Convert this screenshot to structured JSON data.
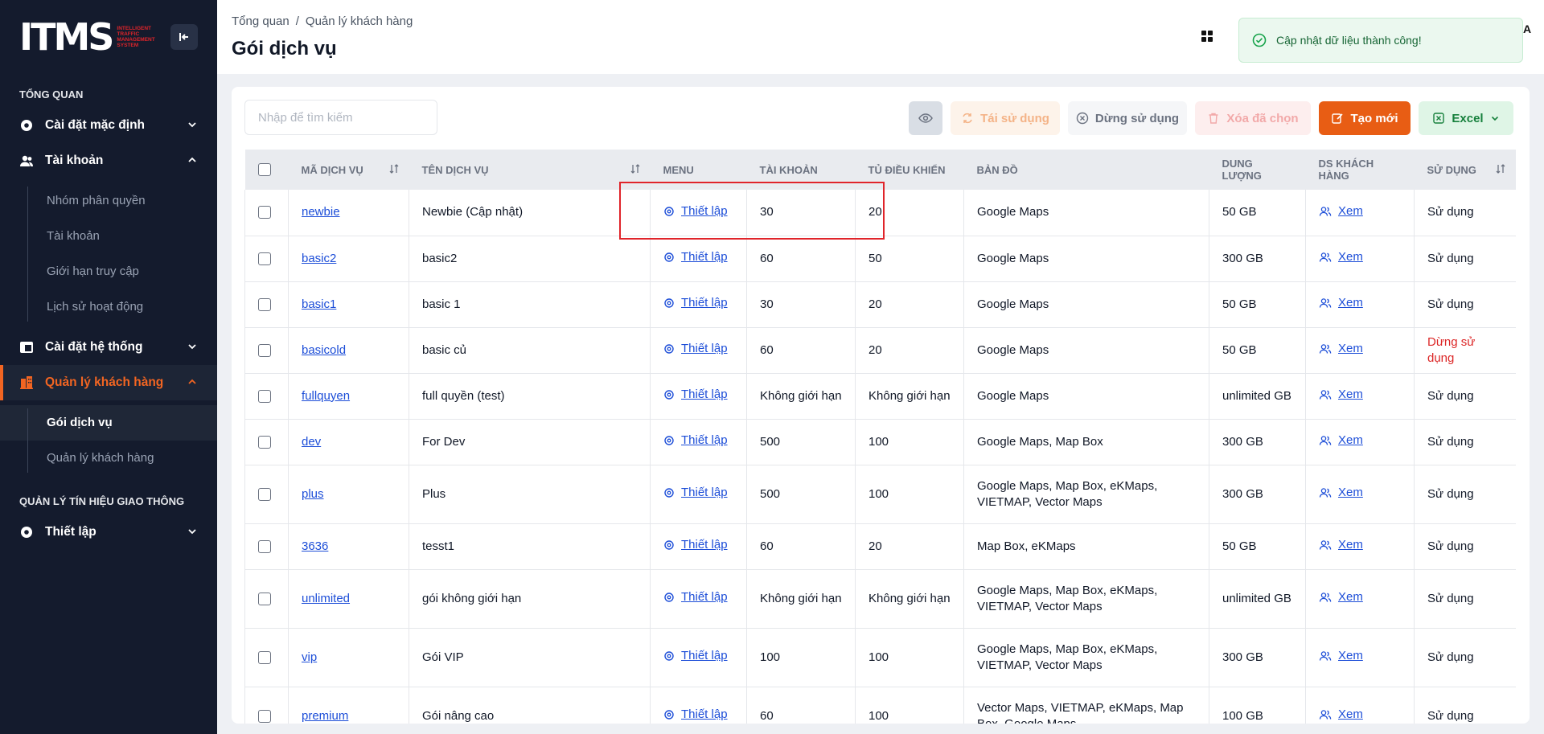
{
  "sidebar": {
    "logo_text": "ITMS",
    "logo_sub": "INTELLIGENT TRAFFIC MANAGEMENT SYSTEM",
    "section_overview": "TỔNG QUAN",
    "default_settings": "Cài đặt mặc định",
    "accounts": "Tài khoản",
    "accounts_sub": [
      "Nhóm phân quyền",
      "Tài khoản",
      "Giới hạn truy cập",
      "Lịch sử hoạt động"
    ],
    "system_settings": "Cài đặt hệ thống",
    "customer_mgmt": "Quản lý khách hàng",
    "customer_sub": [
      "Gói dịch vụ",
      "Quản lý khách hàng"
    ],
    "section_traffic": "QUẢN LÝ TÍN HIỆU GIAO THÔNG",
    "setup": "Thiết lập"
  },
  "header": {
    "breadcrumb": [
      "Tổng quan",
      "/",
      "Quản lý khách hàng"
    ],
    "title": "Gói dịch vụ",
    "user_initial": "A",
    "toast": "Cập nhật dữ liệu thành công!"
  },
  "toolbar": {
    "search_placeholder": "Nhập để tìm kiếm",
    "reuse": "Tái sử dụng",
    "stop": "Dừng sử dụng",
    "delete_selected": "Xóa đã chọn",
    "create": "Tạo mới",
    "excel": "Excel"
  },
  "table": {
    "columns": [
      "MÃ DỊCH VỤ",
      "TÊN DỊCH VỤ",
      "MENU",
      "TÀI KHOẢN",
      "TỦ ĐIỀU KHIỂN",
      "BẢN ĐỒ",
      "DUNG LƯỢNG",
      "DS KHÁCH HÀNG",
      "SỬ DỤNG"
    ],
    "menu_link": "Thiết lập",
    "view_link": "Xem",
    "rows": [
      {
        "code": "newbie",
        "name": "Newbie (Cập nhật)",
        "accounts": "30",
        "controllers": "20",
        "maps": "Google Maps",
        "storage": "50 GB",
        "status": "Sử dụng"
      },
      {
        "code": "basic2",
        "name": "basic2",
        "accounts": "60",
        "controllers": "50",
        "maps": "Google Maps",
        "storage": "300 GB",
        "status": "Sử dụng"
      },
      {
        "code": "basic1",
        "name": "basic 1",
        "accounts": "30",
        "controllers": "20",
        "maps": "Google Maps",
        "storage": "50 GB",
        "status": "Sử dụng"
      },
      {
        "code": "basicold",
        "name": "basic củ",
        "accounts": "60",
        "controllers": "20",
        "maps": "Google Maps",
        "storage": "50 GB",
        "status": "Dừng sử dụng"
      },
      {
        "code": "fullquyen",
        "name": "full quyền (test)",
        "accounts": "Không giới hạn",
        "controllers": "Không giới hạn",
        "maps": "Google Maps",
        "storage": "unlimited GB",
        "status": "Sử dụng"
      },
      {
        "code": "dev",
        "name": "For Dev",
        "accounts": "500",
        "controllers": "100",
        "maps": "Google Maps, Map Box",
        "storage": "300 GB",
        "status": "Sử dụng"
      },
      {
        "code": "plus",
        "name": "Plus",
        "accounts": "500",
        "controllers": "100",
        "maps": "Google Maps, Map Box, eKMaps, VIETMAP, Vector Maps",
        "storage": "300 GB",
        "status": "Sử dụng"
      },
      {
        "code": "3636",
        "name": "tesst1",
        "accounts": "60",
        "controllers": "20",
        "maps": "Map Box, eKMaps",
        "storage": "50 GB",
        "status": "Sử dụng"
      },
      {
        "code": "unlimited",
        "name": "gói không giới hạn",
        "accounts": "Không giới hạn",
        "controllers": "Không giới hạn",
        "maps": "Google Maps, Map Box, eKMaps, VIETMAP, Vector Maps",
        "storage": "unlimited GB",
        "status": "Sử dụng"
      },
      {
        "code": "vip",
        "name": "Gói VIP",
        "accounts": "100",
        "controllers": "100",
        "maps": "Google Maps, Map Box, eKMaps, VIETMAP, Vector Maps",
        "storage": "300 GB",
        "status": "Sử dụng"
      },
      {
        "code": "premium",
        "name": "Gói nâng cao",
        "accounts": "60",
        "controllers": "100",
        "maps": "Vector Maps, VIETMAP, eKMaps, Map Box, Google Maps",
        "storage": "100 GB",
        "status": "Sử dụng"
      }
    ]
  },
  "colors": {
    "accent": "#e85d14",
    "sidebar_bg": "#141b2d",
    "link": "#1d4ed8",
    "danger": "#dc2626"
  }
}
